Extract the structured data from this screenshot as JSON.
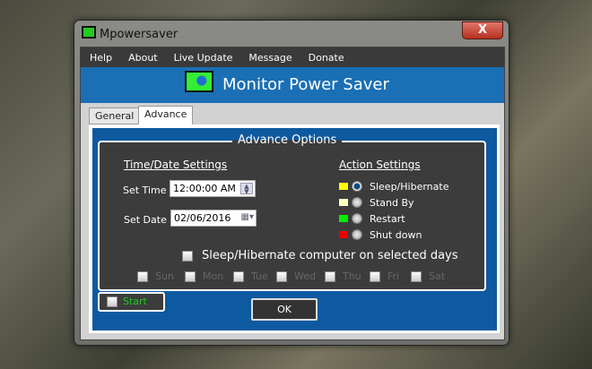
{
  "window": {
    "title": "Mpowersaver",
    "close": "X"
  },
  "menu": [
    "Help",
    "About",
    "Live Update",
    "Message",
    "Donate"
  ],
  "banner": {
    "title": "Monitor Power Saver"
  },
  "tabs": [
    {
      "label": "General",
      "active": false
    },
    {
      "label": "Advance",
      "active": true
    }
  ],
  "advance": {
    "group_title": "Advance Options",
    "time_date_heading": "Time/Date Settings",
    "set_time_label": "Set Time",
    "set_time_value": "12:00:00 AM",
    "set_date_label": "Set Date",
    "set_date_value": "02/06/2016",
    "action_heading": "Action Settings",
    "actions": [
      {
        "label": "Sleep/Hibernate",
        "color": "#ffff00",
        "selected": true
      },
      {
        "label": "Stand By",
        "color": "#ffffc0",
        "selected": false
      },
      {
        "label": "Restart",
        "color": "#00e000",
        "selected": false
      },
      {
        "label": "Shut down",
        "color": "#e00000",
        "selected": false
      }
    ],
    "selected_days_label": "Sleep/Hibernate computer on selected days",
    "days": [
      "Sun",
      "Mon",
      "Tue",
      "Wed",
      "Thu",
      "Fri",
      "Sat"
    ],
    "start_label": "Start",
    "ok_label": "OK"
  }
}
